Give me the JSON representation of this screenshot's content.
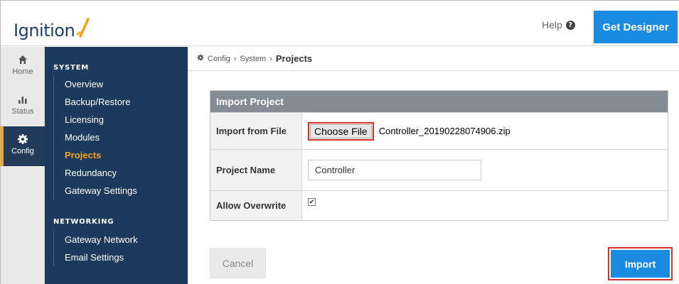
{
  "header": {
    "logo_text": "Ignition",
    "help_label": "Help",
    "help_icon": "?",
    "get_designer_label": "Get Designer",
    "accent_color": "#1a8be0"
  },
  "rail": {
    "items": [
      {
        "label": "Home",
        "icon": "home-icon"
      },
      {
        "label": "Status",
        "icon": "bar-chart-icon"
      },
      {
        "label": "Config",
        "icon": "gear-icon",
        "active": true
      }
    ]
  },
  "sidebar": {
    "system_heading": "SYSTEM",
    "system_items": [
      "Overview",
      "Backup/Restore",
      "Licensing",
      "Modules",
      "Projects",
      "Redundancy",
      "Gateway Settings"
    ],
    "active_item": "Projects",
    "networking_heading": "NETWORKING",
    "networking_items": [
      "Gateway Network",
      "Email Settings"
    ]
  },
  "breadcrumb": {
    "icon": "gear-icon",
    "items": [
      "Config",
      "System",
      "Projects"
    ],
    "separator": "›"
  },
  "panel": {
    "title": "Import Project",
    "import_from_file_label": "Import from File",
    "choose_file_label": "Choose File",
    "file_name": "Controller_20190228074906.zip",
    "project_name_label": "Project Name",
    "project_name_value": "Controller",
    "allow_overwrite_label": "Allow Overwrite",
    "allow_overwrite_checked": true,
    "check_glyph": "✔"
  },
  "actions": {
    "cancel_label": "Cancel",
    "import_label": "Import"
  },
  "colors": {
    "sidebar_bg": "#1c3a5e",
    "active_nav": "#f4a11c",
    "highlight_outline": "#d9322b"
  }
}
